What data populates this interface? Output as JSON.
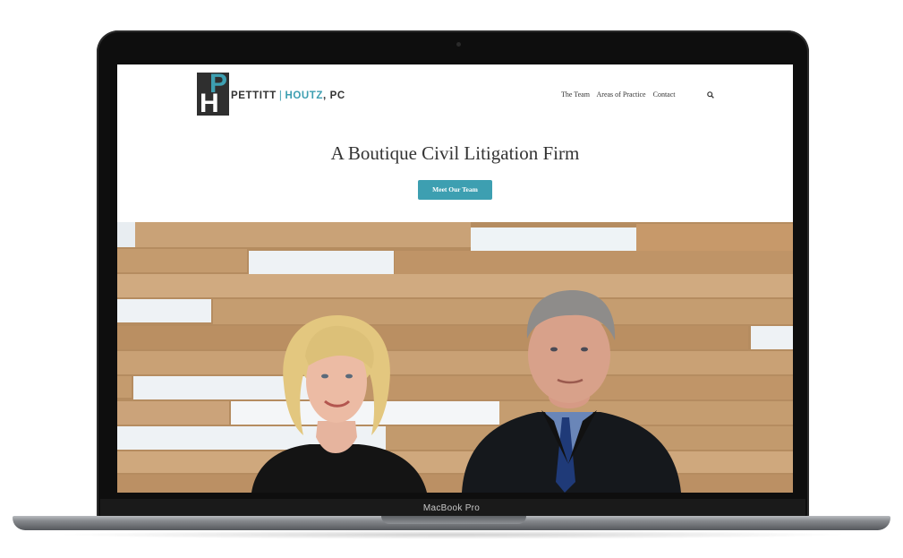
{
  "device": {
    "label": "MacBook Pro"
  },
  "site": {
    "logo": {
      "mark_top": "P",
      "mark_bottom": "H",
      "name_primary": "PETTITT",
      "separator": "|",
      "name_secondary": "HOUTZ",
      "suffix": ", PC"
    },
    "nav": {
      "items": [
        {
          "label": "The Team"
        },
        {
          "label": "Areas of Practice"
        },
        {
          "label": "Contact"
        }
      ],
      "search_icon": "magnifier-icon"
    },
    "hero": {
      "title": "A Boutique Civil Litigation Firm",
      "cta_label": "Meet Our Team"
    },
    "photo": {
      "subject": "two-attorneys-in-front-of-wood-slat-wall"
    }
  },
  "colors": {
    "accent": "#3d9fb1",
    "text": "#333333",
    "wood": "#c39a6b",
    "laptop_bezel": "#0e0e0e"
  }
}
